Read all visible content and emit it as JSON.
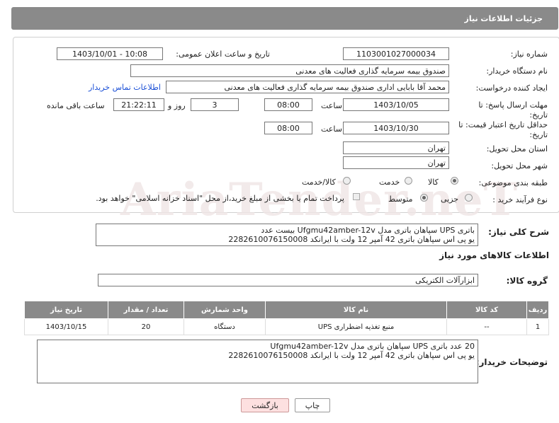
{
  "header": {
    "title": "جزئیات اطلاعات نیاز"
  },
  "fields": {
    "need_number_label": "شماره نیاز:",
    "need_number": "1103001027000034",
    "announce_label": "تاریخ و ساعت اعلان عمومی:",
    "announce_value": "1403/10/01 - 10:08",
    "buyer_label": "نام دستگاه خریدار:",
    "buyer_value": "صندوق بیمه سرمایه گذاری فعالیت های معدنی",
    "creator_label": "ایجاد کننده درخواست:",
    "creator_value": "محمد آقا بابایی اداری صندوق بیمه سرمایه گذاری فعالیت های معدنی",
    "contact_link": "اطلاعات تماس خریدار",
    "deadline_label_1": "مهلت ارسال پاسخ: تا",
    "deadline_label_2": "تاریخ:",
    "deadline_date": "1403/10/05",
    "time_label": "ساعت",
    "deadline_time": "08:00",
    "days_value": "3",
    "days_label": "روز و",
    "remaining_time": "21:22:11",
    "remaining_label": "ساعت باقی مانده",
    "validity_label_1": "حداقل تاریخ اعتبار قیمت: تا",
    "validity_label_2": "تاریخ:",
    "validity_date": "1403/10/30",
    "validity_time": "08:00",
    "province_label": "استان محل تحویل:",
    "province_value": "تهران",
    "city_label": "شهر محل تحویل:",
    "city_value": "تهران",
    "category_label": "طبقه بندی موضوعی:",
    "category_options": [
      "کالا",
      "خدمت",
      "کالا/خدمت"
    ],
    "process_label": "نوع فرآیند خرید :",
    "process_options": [
      "جزیی",
      "متوسط"
    ],
    "payment_note": "پرداخت تمام یا بخشی از مبلغ خرید،از محل \"اسناد خزانه اسلامی\" خواهد بود."
  },
  "watermark": "AriaTender.neT",
  "summary": {
    "label": "شرح کلی نیاز:",
    "line1": "باتری UPS سپاهان باتری مدل Ufgmu42amber-12v   بیست عدد",
    "line2": "یو پی اس سپاهان باتری 42 آمپر 12 ولت با ایرانکد 2282610076150008"
  },
  "goods_info_title": "اطلاعات کالاهای مورد نیاز",
  "goods_group": {
    "label": "گروه کالا:",
    "value": "ابزارآلات الکتریکی"
  },
  "table": {
    "headers": [
      "ردیف",
      "کد کالا",
      "نام کالا",
      "واحد شمارش",
      "تعداد / مقدار",
      "تاریخ نیاز"
    ],
    "rows": [
      [
        "1",
        "--",
        "منبع تغذیه اضطراری UPS",
        "دستگاه",
        "20",
        "1403/10/15"
      ]
    ]
  },
  "buyer_desc": {
    "label": "توضیحات خریدار:",
    "line1": "20 عدد باتری UPS سپاهان باتری مدل Ufgmu42amber-12v",
    "line2": "یو پی اس سپاهان باتری 42 آمپر 12 ولت با ایرانکد 2282610076150008"
  },
  "buttons": {
    "print": "چاپ",
    "back": "بازگشت"
  }
}
